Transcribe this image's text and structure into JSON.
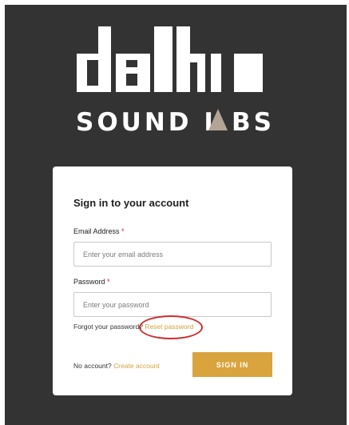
{
  "brand": {
    "wordmark": "delta",
    "tagline_left": "SOUND L",
    "tagline_mid": "A",
    "tagline_right": "BS",
    "accent_color": "#b3a496"
  },
  "form": {
    "title": "Sign in to your account",
    "email": {
      "label": "Email Address",
      "required_mark": "*",
      "placeholder": "Enter your email address",
      "value": ""
    },
    "password": {
      "label": "Password",
      "required_mark": "*",
      "placeholder": "Enter your password",
      "value": ""
    },
    "forgot_text": "Forgot your password?",
    "reset_link": "Reset password",
    "no_account_text": "No account?",
    "create_link": "Create account",
    "submit_label": "SIGN IN"
  },
  "colors": {
    "background": "#333333",
    "link": "#d3a23a",
    "button": "#d9a33d",
    "highlight_circle": "#cd2d2d"
  }
}
